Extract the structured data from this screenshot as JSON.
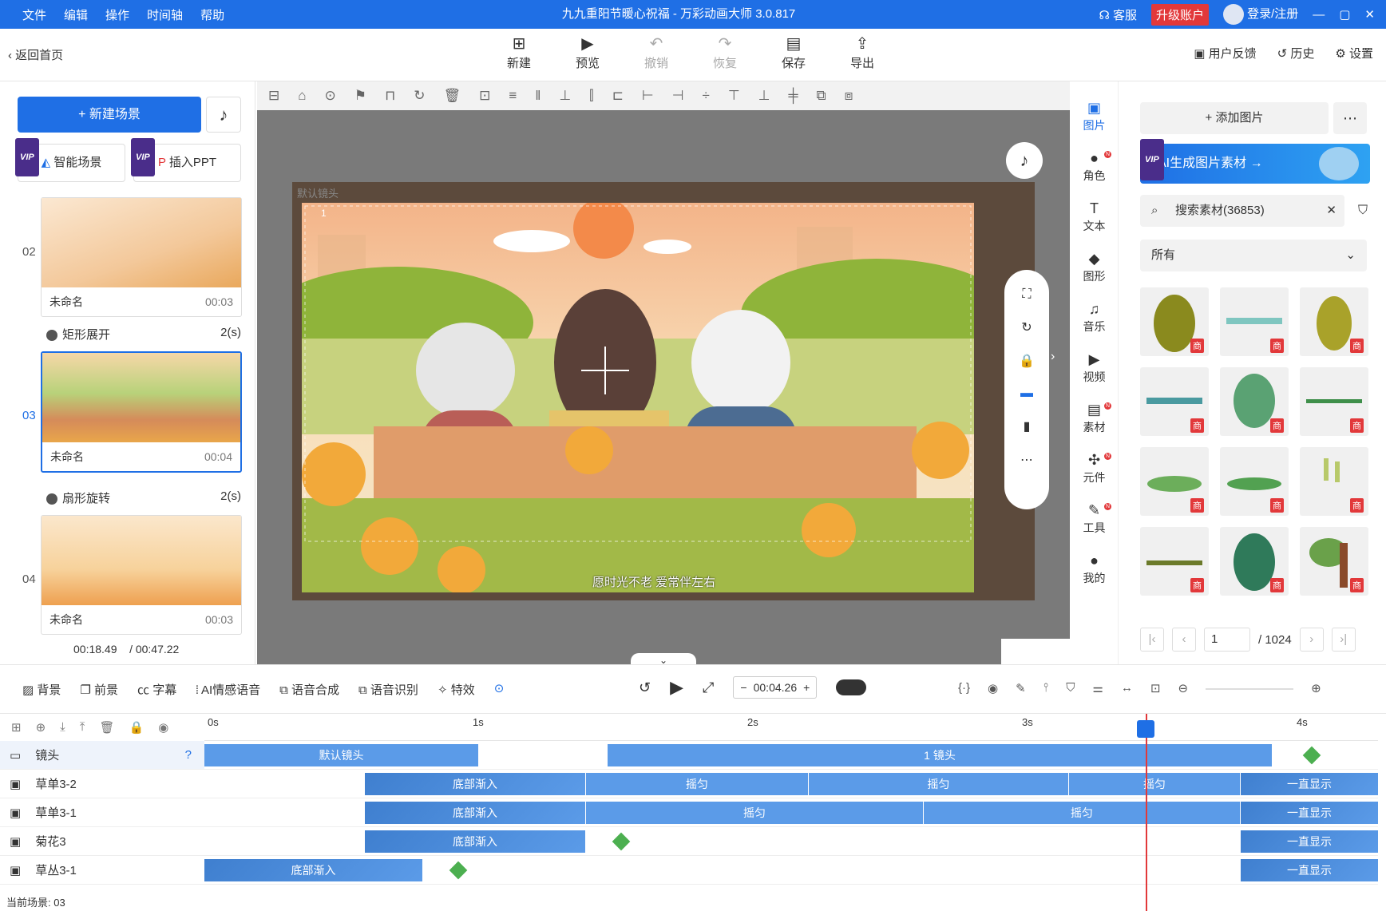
{
  "titlebar": {
    "menu": [
      "文件",
      "编辑",
      "操作",
      "时间轴",
      "帮助"
    ],
    "title": "九九重阳节暖心祝福 - 万彩动画大师 3.0.817",
    "service": "客服",
    "upgrade": "升级账户",
    "login": "登录/注册"
  },
  "toolbar": {
    "back": "返回首页",
    "buttons": [
      {
        "label": "新建",
        "icon": "plus-icon"
      },
      {
        "label": "预览",
        "icon": "play-icon"
      },
      {
        "label": "撤销",
        "icon": "undo-icon"
      },
      {
        "label": "恢复",
        "icon": "redo-icon"
      },
      {
        "label": "保存",
        "icon": "save-icon"
      },
      {
        "label": "导出",
        "icon": "export-icon"
      }
    ],
    "right": [
      "用户反馈",
      "历史",
      "设置"
    ]
  },
  "left": {
    "new_scene": "新建场景",
    "smart_scene": "智能场景",
    "insert_ppt": "插入PPT",
    "vip": "VIP",
    "scenes": [
      {
        "num": "02",
        "name": "未命名",
        "time": "00:03",
        "transition": "矩形展开",
        "tdur": "2(s)"
      },
      {
        "num": "03",
        "name": "未命名",
        "time": "00:04",
        "transition": "扇形旋转",
        "tdur": "2(s)"
      },
      {
        "num": "04",
        "name": "未命名",
        "time": "00:03"
      }
    ],
    "current_time": "00:18.49",
    "total_time": "/ 00:47.22"
  },
  "canvas": {
    "caption": "愿时光不老 爱常伴左右",
    "camera_label": "默认镜头",
    "camera_num": "1"
  },
  "rightnav": [
    {
      "label": "图片",
      "icon": "image-icon"
    },
    {
      "label": "角色",
      "icon": "person-icon"
    },
    {
      "label": "文本",
      "icon": "text-icon"
    },
    {
      "label": "图形",
      "icon": "shape-icon"
    },
    {
      "label": "音乐",
      "icon": "music-icon"
    },
    {
      "label": "视频",
      "icon": "video-icon"
    },
    {
      "label": "素材",
      "icon": "material-icon"
    },
    {
      "label": "元件",
      "icon": "component-icon"
    },
    {
      "label": "工具",
      "icon": "tool-icon"
    },
    {
      "label": "我的",
      "icon": "user-icon"
    }
  ],
  "assets": {
    "add_image": "添加图片",
    "ai_banner": "AI生成图片素材 →",
    "search_placeholder": "搜索素材(36853)",
    "category": "所有",
    "badge": "商",
    "page": "1",
    "page_total": "/ 1024"
  },
  "timeline_bar": {
    "left": [
      "背景",
      "前景",
      "字幕",
      "AI情感语音",
      "语音合成",
      "语音识别",
      "特效"
    ],
    "time": "00:04.26"
  },
  "tracks": {
    "ruler": [
      "0s",
      "1s",
      "2s",
      "3s",
      "4s"
    ],
    "rows": [
      {
        "name": "镜头",
        "clips": [
          {
            "label": "默认镜头"
          },
          {
            "label": "1 镜头"
          }
        ]
      },
      {
        "name": "草单3-2",
        "clips": [
          {
            "label": "底部渐入"
          },
          {
            "label": "摇匀"
          },
          {
            "label": "摇匀"
          },
          {
            "label": "摇匀"
          },
          {
            "label": "一直显示"
          }
        ]
      },
      {
        "name": "草单3-1",
        "clips": [
          {
            "label": "底部渐入"
          },
          {
            "label": "摇匀"
          },
          {
            "label": "摇匀"
          },
          {
            "label": "一直显示"
          }
        ]
      },
      {
        "name": "菊花3",
        "clips": [
          {
            "label": "底部渐入"
          },
          {
            "label": "一直显示"
          }
        ]
      },
      {
        "name": "草丛3-1",
        "clips": [
          {
            "label": "底部渐入"
          },
          {
            "label": "一直显示"
          }
        ]
      }
    ],
    "current_scene": "当前场景: 03"
  }
}
